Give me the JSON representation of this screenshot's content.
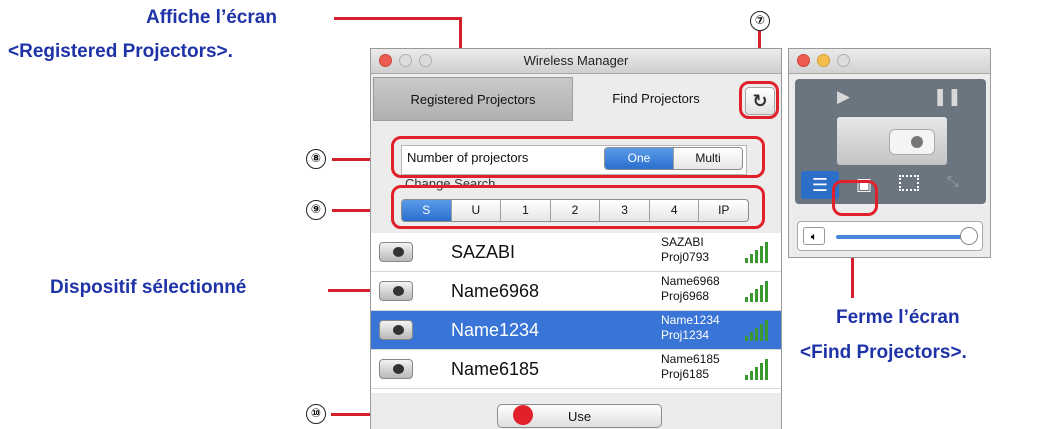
{
  "annotations": {
    "affiche": [
      "Affiche l’écran",
      "<Registered Projectors>."
    ],
    "dispositif": "Dispositif sélectionné",
    "ferme": [
      "Ferme l’écran",
      "<Find Projectors>."
    ],
    "numbers": [
      "⑦",
      "⑧",
      "⑨",
      "⑩"
    ]
  },
  "window": {
    "title": "Wireless Manager",
    "tabs": {
      "registered": "Registered Projectors",
      "find": "Find Projectors"
    },
    "number_label": "Number of projectors",
    "number_options": [
      "One",
      "Multi"
    ],
    "number_selected": "One",
    "change_search_label": "Change Search",
    "search_options": [
      "S",
      "U",
      "1",
      "2",
      "3",
      "4",
      "IP"
    ],
    "search_selected": "S",
    "devices": [
      {
        "name": "SAZABI",
        "host": "SAZABI",
        "id": "Proj0793"
      },
      {
        "name": "Name6968",
        "host": "Name6968",
        "id": "Proj6968"
      },
      {
        "name": "Name1234",
        "host": "Name1234",
        "id": "Proj1234"
      },
      {
        "name": "Name6185",
        "host": "Name6185",
        "id": "Proj6185"
      }
    ],
    "selected_device": "Name1234",
    "use_label": "Use"
  },
  "small_window": {
    "icons": [
      "play-icon",
      "pause-icon",
      "projector-icon",
      "list-icon",
      "toolbox-icon",
      "selection-icon",
      "resize-icon",
      "speaker-icon"
    ],
    "volume_level": 1.0
  },
  "colors": {
    "callout": "#1f33a8",
    "red": "#e0202a",
    "selection": "#3875d7"
  }
}
